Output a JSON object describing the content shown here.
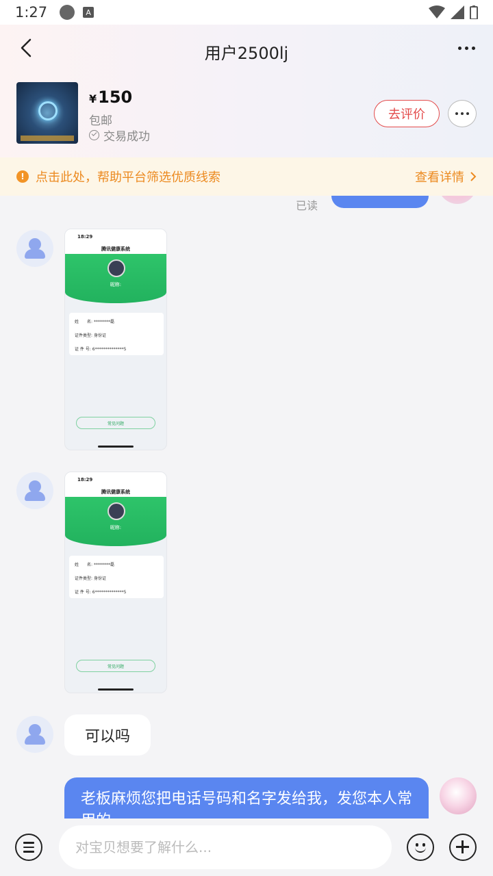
{
  "status_bar": {
    "time": "1:27",
    "a_badge": "A"
  },
  "header": {
    "title": "用户2500lj"
  },
  "product": {
    "currency": "¥",
    "price": "150",
    "shipping": "包邮",
    "deal_status": "交易成功",
    "review_label": "去评价"
  },
  "notice": {
    "text": "点击此处，帮助平台筛选优质线索",
    "link": "查看详情"
  },
  "chat": {
    "read_label": "已读",
    "screenshot": {
      "time": "18:29",
      "title": "腾讯健康系统",
      "nickname": "昵称:",
      "name_label": "姓　　名:",
      "name_value": "********磊",
      "id_type_label": "证件类型:",
      "id_type_value": "身份证",
      "id_no_label": "证 件 号:",
      "id_no_value": "6**************5",
      "faq": "常见问题"
    },
    "peer_text": "可以吗",
    "my_text": "老板麻烦您把电话号码和名字发给我，发您本人常用的"
  },
  "input": {
    "placeholder": "对宝贝想要了解什么..."
  },
  "colors": {
    "accent": "#5a86f0",
    "review": "#e34a4a",
    "notice": "#ec8a20",
    "green": "#22b25e"
  }
}
